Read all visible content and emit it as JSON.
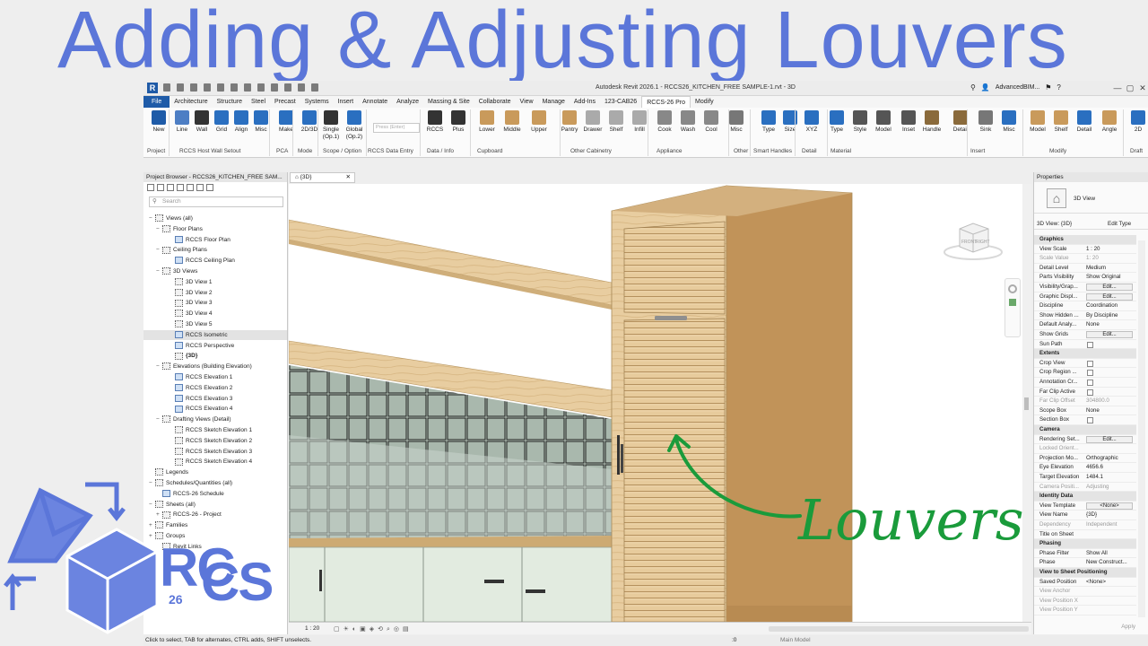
{
  "hero_title": "Adding & Adjusting Louvers",
  "titlebar": {
    "app_title": "Autodesk Revit 2026.1 - RCCS26_KITCHEN_FREE SAMPLE-1.rvt - 3D",
    "user": "AdvancedBIM...",
    "minimize": "—",
    "maximize": "▢",
    "close": "✕"
  },
  "menu_tabs": [
    "File",
    "Architecture",
    "Structure",
    "Steel",
    "Precast",
    "Systems",
    "Insert",
    "Annotate",
    "Analyze",
    "Massing & Site",
    "Collaborate",
    "View",
    "Manage",
    "Add-Ins",
    "123-CAB26",
    "RCCS-26 Pro",
    "Modify"
  ],
  "ribbon": {
    "buttons": [
      {
        "label": "New",
        "icon": "rccs-r-icon",
        "color": "#1e5ba8"
      },
      {
        "label": "Line",
        "icon": "grid-line-icon",
        "color": "#4d7ec4"
      },
      {
        "label": "Wall",
        "icon": "wall-icon",
        "color": "#333333"
      },
      {
        "label": "Grid",
        "icon": "grid-icon",
        "color": "#2a6fc0"
      },
      {
        "label": "Align",
        "icon": "align-icon",
        "color": "#2a6fc0"
      },
      {
        "label": "Misc",
        "icon": "tools-icon",
        "color": "#2a6fc0"
      },
      {
        "label": "Make",
        "icon": "make-icon",
        "color": "#2a6fc0"
      },
      {
        "label": "2D/3D",
        "icon": "2d3d-icon",
        "color": "#2a6fc0"
      },
      {
        "label": "Single\n(Op.1)",
        "icon": "person-icon",
        "color": "#333333"
      },
      {
        "label": "Global\n(Op.2)",
        "icon": "globe-icon",
        "color": "#2a6fc0"
      },
      {
        "label": "RCCS",
        "icon": "cube-stack-icon",
        "color": "#333333"
      },
      {
        "label": "Plus",
        "icon": "plus-icon",
        "color": "#333333"
      },
      {
        "label": "Lower",
        "icon": "lower-cabinet-icon",
        "color": "#c99a5b"
      },
      {
        "label": "Middle",
        "icon": "middle-cabinet-icon",
        "color": "#c99a5b"
      },
      {
        "label": "Upper",
        "icon": "upper-cabinet-icon",
        "color": "#c99a5b"
      },
      {
        "label": "Pantry",
        "icon": "pantry-icon",
        "color": "#c99a5b"
      },
      {
        "label": "Drawer",
        "icon": "drawer-icon",
        "color": "#aaaaaa"
      },
      {
        "label": "Shelf",
        "icon": "shelf-icon",
        "color": "#aaaaaa"
      },
      {
        "label": "Infill",
        "icon": "infill-icon",
        "color": "#aaaaaa"
      },
      {
        "label": "Cook",
        "icon": "cook-icon",
        "color": "#888888"
      },
      {
        "label": "Wash",
        "icon": "wash-icon",
        "color": "#888888"
      },
      {
        "label": "Cool",
        "icon": "cool-icon",
        "color": "#888888"
      },
      {
        "label": "Misc",
        "icon": "misc-icon",
        "color": "#777777"
      },
      {
        "label": "Type",
        "icon": "type-handle-icon",
        "color": "#2a6fc0"
      },
      {
        "label": "Size",
        "icon": "size-icon",
        "color": "#2a6fc0"
      },
      {
        "label": "XYZ",
        "icon": "xyz-icon",
        "color": "#2a6fc0"
      },
      {
        "label": "Type",
        "icon": "type-detail-icon",
        "color": "#2a6fc0"
      },
      {
        "label": "Style",
        "icon": "style-icon",
        "color": "#555555"
      },
      {
        "label": "Model",
        "icon": "model-material-icon",
        "color": "#555555"
      },
      {
        "label": "Inset",
        "icon": "inset-icon",
        "color": "#555555"
      },
      {
        "label": "Handle",
        "icon": "handle-icon",
        "color": "#8a6a3b"
      },
      {
        "label": "Detail",
        "icon": "detail-icon",
        "color": "#8a6a3b"
      },
      {
        "label": "Sink",
        "icon": "sink-icon",
        "color": "#777777"
      },
      {
        "label": "Misc",
        "icon": "misc-insert-icon",
        "color": "#2a6fc0"
      },
      {
        "label": "Model",
        "icon": "model-modify-icon",
        "color": "#c99a5b"
      },
      {
        "label": "Shelf",
        "icon": "shelf-modify-icon",
        "color": "#c99a5b"
      },
      {
        "label": "Detail",
        "icon": "detail-modify-icon",
        "color": "#2a6fc0"
      },
      {
        "label": "Angle",
        "icon": "angle-icon",
        "color": "#c99a5b"
      },
      {
        "label": "2D",
        "icon": "2d-draft-icon",
        "color": "#2a6fc0"
      }
    ],
    "press_enter_placeholder": "Press (Enter)",
    "panels": [
      "Project",
      "RCCS Host Wall Setout",
      "PCA",
      "Mode",
      "Scope / Option",
      "RCCS Data Entry",
      "Data / Info",
      "Cupboard",
      "Other Cabinetry",
      "Appliance",
      "Other",
      "Smart Handles",
      "Detail",
      "Material",
      "Insert",
      "Modify",
      "Draft"
    ]
  },
  "project_browser": {
    "header": "Project Browser - RCCS26_KITCHEN_FREE SAM...",
    "search_placeholder": "Search",
    "items": [
      {
        "label": "Views (all)",
        "toggle": "−"
      },
      {
        "label": "Floor Plans",
        "toggle": "−"
      },
      {
        "label": "RCCS Floor Plan",
        "toggle": ""
      },
      {
        "label": "Ceiling Plans",
        "toggle": "−"
      },
      {
        "label": "RCCS Ceiling Plan",
        "toggle": ""
      },
      {
        "label": "3D Views",
        "toggle": "−"
      },
      {
        "label": "3D View 1",
        "toggle": ""
      },
      {
        "label": "3D View 2",
        "toggle": ""
      },
      {
        "label": "3D View 3",
        "toggle": ""
      },
      {
        "label": "3D View 4",
        "toggle": ""
      },
      {
        "label": "3D View 5",
        "toggle": ""
      },
      {
        "label": "RCCS Isometric",
        "toggle": ""
      },
      {
        "label": "RCCS Perspective",
        "toggle": ""
      },
      {
        "label": "{3D}",
        "toggle": ""
      },
      {
        "label": "Elevations (Building Elevation)",
        "toggle": "−"
      },
      {
        "label": "RCCS Elevation 1",
        "toggle": ""
      },
      {
        "label": "RCCS Elevation 2",
        "toggle": ""
      },
      {
        "label": "RCCS Elevation 3",
        "toggle": ""
      },
      {
        "label": "RCCS Elevation 4",
        "toggle": ""
      },
      {
        "label": "Drafting Views (Detail)",
        "toggle": "−"
      },
      {
        "label": "RCCS Sketch Elevation 1",
        "toggle": ""
      },
      {
        "label": "RCCS Sketch Elevation 2",
        "toggle": ""
      },
      {
        "label": "RCCS Sketch Elevation 3",
        "toggle": ""
      },
      {
        "label": "RCCS Sketch Elevation 4",
        "toggle": ""
      },
      {
        "label": "Legends",
        "toggle": ""
      },
      {
        "label": "Schedules/Quantities (all)",
        "toggle": "−"
      },
      {
        "label": "RCCS-26 Schedule",
        "toggle": ""
      },
      {
        "label": "Sheets (all)",
        "toggle": "−"
      },
      {
        "label": "RCCS-26 - Project",
        "toggle": "+"
      },
      {
        "label": "Families",
        "toggle": "+"
      },
      {
        "label": "Groups",
        "toggle": "+"
      },
      {
        "label": "Revit Links",
        "toggle": ""
      }
    ]
  },
  "view_tab": "{3D}",
  "annotation": "Louvers",
  "view_bar": {
    "scale": "1 : 20",
    "model": "Main Model"
  },
  "properties": {
    "header": "Properties",
    "type_name": "3D View",
    "instance_selector": "3D View: {3D}",
    "edit_type": "Edit Type",
    "rows": [
      {
        "k": "Graphics",
        "sec": true
      },
      {
        "k": "View Scale",
        "v": "1 : 20"
      },
      {
        "k": "Scale Value",
        "v": "1:  20",
        "grey": true
      },
      {
        "k": "Detail Level",
        "v": "Medium"
      },
      {
        "k": "Parts Visibility",
        "v": "Show Original"
      },
      {
        "k": "Visibility/Grap...",
        "edit": "Edit..."
      },
      {
        "k": "Graphic Displ...",
        "edit": "Edit..."
      },
      {
        "k": "Discipline",
        "v": "Coordination"
      },
      {
        "k": "Show Hidden ...",
        "v": "By Discipline"
      },
      {
        "k": "Default Analy...",
        "v": "None"
      },
      {
        "k": "Show Grids",
        "edit": "Edit..."
      },
      {
        "k": "Sun Path",
        "cb": true
      },
      {
        "k": "Extents",
        "sec": true
      },
      {
        "k": "Crop View",
        "cb": true
      },
      {
        "k": "Crop Region ...",
        "cb": true
      },
      {
        "k": "Annotation Cr...",
        "cb": true
      },
      {
        "k": "Far Clip Active",
        "cb": true
      },
      {
        "k": "Far Clip Offset",
        "v": "304800.0",
        "grey": true
      },
      {
        "k": "Scope Box",
        "v": "None"
      },
      {
        "k": "Section Box",
        "cb": true
      },
      {
        "k": "Camera",
        "sec": true
      },
      {
        "k": "Rendering Set...",
        "edit": "Edit..."
      },
      {
        "k": "Locked Orient...",
        "grey": true
      },
      {
        "k": "Projection Mo...",
        "v": "Orthographic"
      },
      {
        "k": "Eye Elevation",
        "v": "4656.6"
      },
      {
        "k": "Target Elevation",
        "v": "1484.1"
      },
      {
        "k": "Camera Positi...",
        "v": "Adjusting",
        "grey": true
      },
      {
        "k": "Identity Data",
        "sec": true
      },
      {
        "k": "View Template",
        "edit": "<None>"
      },
      {
        "k": "View Name",
        "v": "{3D}"
      },
      {
        "k": "Dependency",
        "v": "Independent",
        "grey": true
      },
      {
        "k": "Title on Sheet",
        "v": ""
      },
      {
        "k": "Phasing",
        "sec": true
      },
      {
        "k": "Phase Filter",
        "v": "Show All"
      },
      {
        "k": "Phase",
        "v": "New Construct..."
      },
      {
        "k": "View to Sheet Positioning",
        "sec": true
      },
      {
        "k": "Saved Position",
        "v": "<None>"
      },
      {
        "k": "View Anchor",
        "grey": true
      },
      {
        "k": "View Position X",
        "grey": true
      },
      {
        "k": "View Position Y",
        "grey": true
      }
    ],
    "apply": "Apply"
  },
  "status_bar": "Click to select, TAB for alternates, CTRL adds, SHIFT unselects.",
  "status_right": ":0",
  "viewcube": {
    "front": "FRONT",
    "right": "RIGHT"
  },
  "logo": {
    "top": "RC",
    "bottom": "CS",
    "num": "26"
  }
}
